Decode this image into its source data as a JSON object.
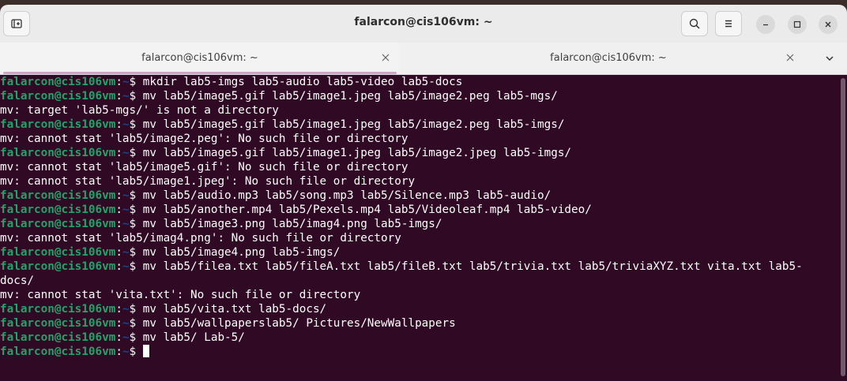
{
  "window": {
    "title": "falarcon@cis106vm: ~"
  },
  "tabs": [
    {
      "label": "falarcon@cis106vm: ~",
      "active": true
    },
    {
      "label": "falarcon@cis106vm: ~",
      "active": false
    }
  ],
  "icons": {
    "new_tab": "new-tab-icon",
    "search": "search-icon",
    "menu": "hamburger-menu-icon",
    "minimize": "minimize-icon",
    "maximize": "maximize-icon",
    "close": "close-icon",
    "tab_close": "close-icon",
    "tab_dropdown": "chevron-down-icon"
  },
  "colors": {
    "terminal_bg": "#300a24",
    "prompt_user": "#26a269",
    "prompt_path": "#12488b",
    "text": "#ffffff"
  },
  "terminal": {
    "prompt_user": "falarcon@cis106vm",
    "prompt_sep": ":",
    "prompt_path": "~",
    "prompt_symbol": "$ ",
    "lines": [
      {
        "type": "cmd",
        "text": "mkdir lab5-imgs lab5-audio lab5-video lab5-docs"
      },
      {
        "type": "cmd",
        "text": "mv lab5/image5.gif lab5/image1.jpeg lab5/image2.peg lab5-mgs/"
      },
      {
        "type": "out",
        "text": "mv: target 'lab5-mgs/' is not a directory"
      },
      {
        "type": "cmd",
        "text": "mv lab5/image5.gif lab5/image1.jpeg lab5/image2.peg lab5-imgs/"
      },
      {
        "type": "out",
        "text": "mv: cannot stat 'lab5/image2.peg': No such file or directory"
      },
      {
        "type": "cmd",
        "text": "mv lab5/image5.gif lab5/image1.jpeg lab5/image2.jpeg lab5-imgs/"
      },
      {
        "type": "out",
        "text": "mv: cannot stat 'lab5/image5.gif': No such file or directory"
      },
      {
        "type": "out",
        "text": "mv: cannot stat 'lab5/image1.jpeg': No such file or directory"
      },
      {
        "type": "cmd",
        "text": "mv lab5/audio.mp3 lab5/song.mp3 lab5/Silence.mp3 lab5-audio/"
      },
      {
        "type": "cmd",
        "text": "mv lab5/another.mp4 lab5/Pexels.mp4 lab5/Videoleaf.mp4 lab5-video/"
      },
      {
        "type": "cmd",
        "text": "mv lab5/image3.png lab5/imag4.png lab5-imgs/"
      },
      {
        "type": "out",
        "text": "mv: cannot stat 'lab5/imag4.png': No such file or directory"
      },
      {
        "type": "cmd",
        "text": "mv lab5/image4.png lab5-imgs/"
      },
      {
        "type": "cmd",
        "text": "mv lab5/filea.txt lab5/fileA.txt lab5/fileB.txt lab5/trivia.txt lab5/triviaXYZ.txt vita.txt lab5-"
      },
      {
        "type": "out",
        "text": "docs/"
      },
      {
        "type": "out",
        "text": "mv: cannot stat 'vita.txt': No such file or directory"
      },
      {
        "type": "cmd",
        "text": "mv lab5/vita.txt lab5-docs/"
      },
      {
        "type": "cmd",
        "text": "mv lab5/wallpaperslab5/ Pictures/NewWallpapers"
      },
      {
        "type": "cmd",
        "text": "mv lab5/ Lab-5/"
      },
      {
        "type": "cmd",
        "text": "",
        "cursor": true
      }
    ]
  }
}
